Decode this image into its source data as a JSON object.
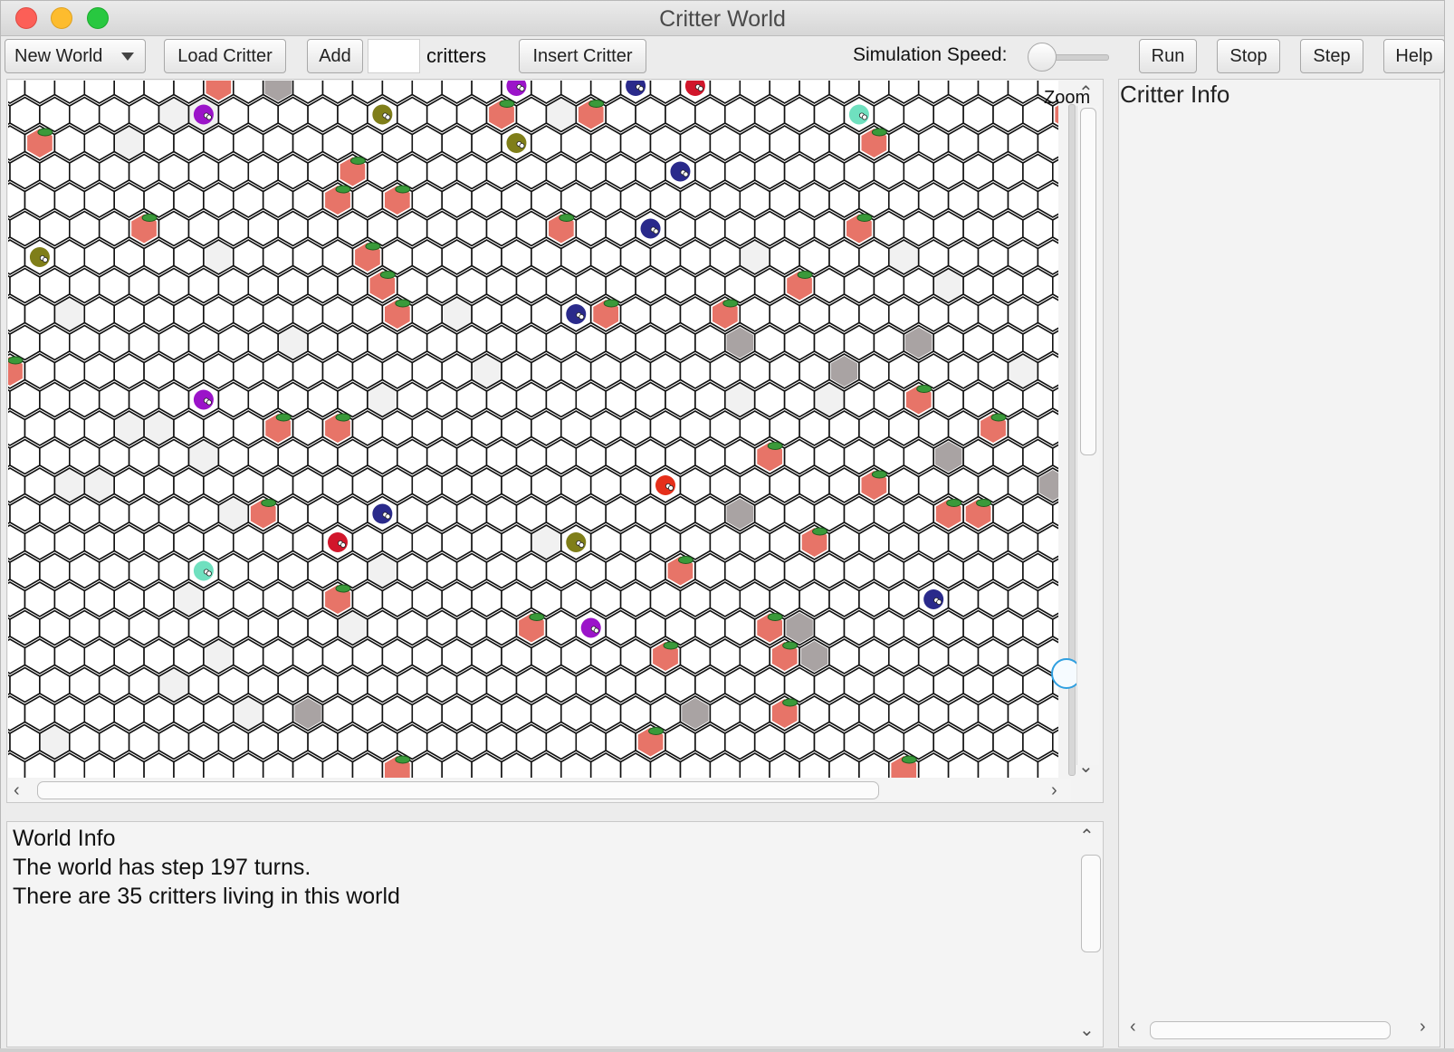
{
  "window": {
    "title": "Critter World"
  },
  "toolbar": {
    "new_world_label": "New World",
    "load_critter_label": "Load Critter",
    "add_label": "Add",
    "critters_label": "critters",
    "count_value": "",
    "insert_critter_label": "Insert Critter",
    "speed_label": "Simulation Speed:",
    "speed_value": 0.1,
    "run_label": "Run",
    "stop_label": "Stop",
    "step_label": "Step",
    "help_label": "Help"
  },
  "world_view": {
    "zoom_label": "Zoom",
    "zoom_value": 0.85
  },
  "world_info": {
    "heading": "World Info",
    "line1": "The world has step 197 turns.",
    "line2": "There are 35 critters living in this world"
  },
  "critter_info": {
    "heading": "Critter Info"
  },
  "colors": {
    "food": "#e77468",
    "rock": "#a9a3a3",
    "critter_purple": "#9b14c9",
    "critter_olive": "#7f7e19",
    "critter_navy": "#2a2a8b",
    "critter_red": "#d1162b",
    "critter_teal": "#6fe0bf",
    "critter_orange_red": "#e52f1a"
  }
}
